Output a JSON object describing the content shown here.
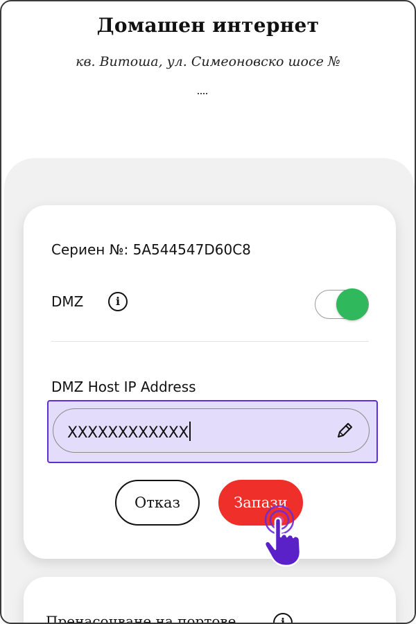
{
  "header": {
    "title": "Домашен интернет",
    "address": "кв. Витоша, ул. Симеоновско шосе №"
  },
  "device": {
    "serial_text": "Сериен №: 5A544547D60C8"
  },
  "dmz": {
    "label": "DMZ",
    "info_icon": "info-icon",
    "enabled": true,
    "toggle_color": "#2fb85c"
  },
  "ip_field": {
    "label": "DMZ Host IP Address",
    "value": "XXXXXXXXXXXX",
    "highlight_color": "#e4dcfb",
    "edit_icon": "pencil-icon"
  },
  "actions": {
    "cancel_label": "Отказ",
    "save_label": "Запази",
    "save_color": "#ee2f2a"
  },
  "next_section": {
    "title": "Пренасочване на портове"
  }
}
